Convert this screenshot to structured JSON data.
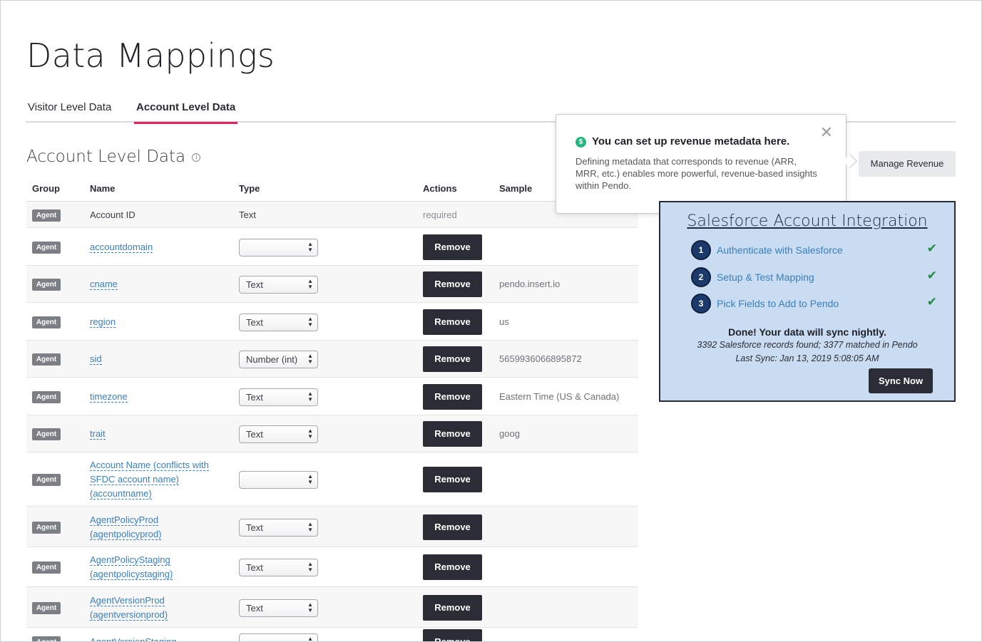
{
  "page": {
    "title": "Data Mappings"
  },
  "tabs": [
    {
      "label": "Visitor Level Data",
      "active": false
    },
    {
      "label": "Account Level Data",
      "active": true
    }
  ],
  "section": {
    "title": "Account Level Data",
    "info_icon": "info-icon"
  },
  "table": {
    "headers": {
      "group": "Group",
      "name": "Name",
      "type": "Type",
      "actions": "Actions",
      "sample": "Sample"
    },
    "rows": [
      {
        "group": "Agent",
        "name": "Account ID",
        "type": "Text",
        "action": "required",
        "sample": ""
      },
      {
        "group": "Agent",
        "name": "accountdomain",
        "type": "",
        "action": "Remove",
        "sample": ""
      },
      {
        "group": "Agent",
        "name": "cname",
        "type": "Text",
        "action": "Remove",
        "sample": "pendo.insert.io"
      },
      {
        "group": "Agent",
        "name": "region",
        "type": "Text",
        "action": "Remove",
        "sample": "us"
      },
      {
        "group": "Agent",
        "name": "sid",
        "type": "Number (int)",
        "action": "Remove",
        "sample": "5659936066895872"
      },
      {
        "group": "Agent",
        "name": "timezone",
        "type": "Text",
        "action": "Remove",
        "sample": "Eastern Time (US & Canada)"
      },
      {
        "group": "Agent",
        "name": "trait",
        "type": "Text",
        "action": "Remove",
        "sample": "goog"
      },
      {
        "group": "Agent",
        "name_lines": [
          "Account Name (conflicts with",
          "SFDC account name)",
          "(accountname)"
        ],
        "type": "",
        "action": "Remove",
        "sample": ""
      },
      {
        "group": "Agent",
        "name_lines": [
          "AgentPolicyProd",
          "(agentpolicyprod)"
        ],
        "type": "Text",
        "action": "Remove",
        "sample": ""
      },
      {
        "group": "Agent",
        "name_lines": [
          "AgentPolicyStaging",
          "(agentpolicystaging)"
        ],
        "type": "Text",
        "action": "Remove",
        "sample": ""
      },
      {
        "group": "Agent",
        "name_lines": [
          "AgentVersionProd",
          "(agentversionprod)"
        ],
        "type": "Text",
        "action": "Remove",
        "sample": ""
      },
      {
        "group": "Agent",
        "name_lines": [
          "AgentVersionStaging"
        ],
        "type": "",
        "action": "Remove",
        "sample": ""
      }
    ]
  },
  "manage_revenue": {
    "label": "Manage Revenue"
  },
  "popover": {
    "heading": "You can set up revenue metadata here.",
    "body": "Defining metadata that corresponds to revenue (ARR, MRR, etc.) enables more powerful, revenue-based insights within Pendo.",
    "icon": "dollar-icon",
    "close_icon": "close-icon"
  },
  "salesforce": {
    "title": "Salesforce Account Integration",
    "steps": [
      {
        "num": "1",
        "label": "Authenticate with Salesforce",
        "done": true
      },
      {
        "num": "2",
        "label": "Setup & Test Mapping",
        "done": true
      },
      {
        "num": "3",
        "label": "Pick Fields to Add to Pendo",
        "done": true
      }
    ],
    "done_text": "Done! Your data will sync nightly.",
    "records_text": "3392 Salesforce records found; 3377 matched in Pendo",
    "last_sync": "Last Sync: Jan 13, 2019 5:08:05 AM",
    "sync_button": "Sync Now",
    "check_glyph": "✔"
  }
}
